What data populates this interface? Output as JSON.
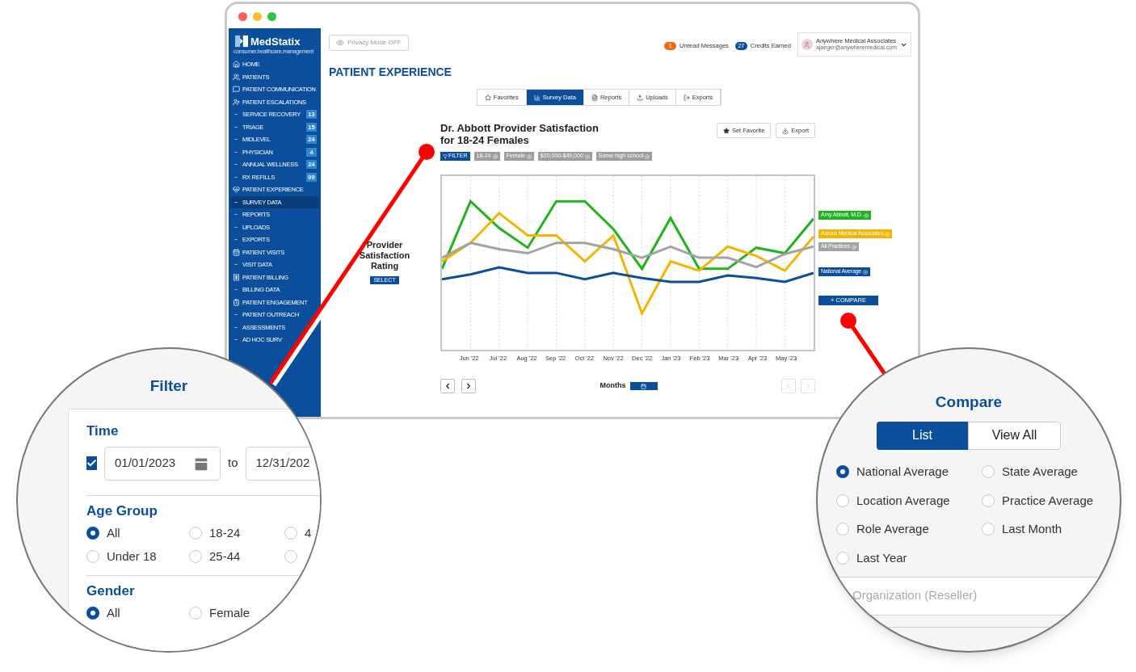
{
  "logo": {
    "name": "MedStatix",
    "tagline": "consumer.healthcare.management"
  },
  "sidebar": {
    "items": [
      {
        "kind": "section",
        "label": "HOME",
        "selected": false
      },
      {
        "kind": "section",
        "label": "PATIENTS",
        "selected": false
      },
      {
        "kind": "section",
        "label": "PATIENT COMMUNICATION",
        "selected": false
      },
      {
        "kind": "section",
        "label": "PATIENT ESCALATIONS",
        "selected": false
      },
      {
        "kind": "sub",
        "label": "SERVICE RECOVERY",
        "count": "13",
        "selected": false
      },
      {
        "kind": "sub",
        "label": "TRIAGE",
        "count": "15",
        "selected": false
      },
      {
        "kind": "sub",
        "label": "MIDLEVEL",
        "count": "24",
        "selected": false
      },
      {
        "kind": "sub",
        "label": "PHYSICIAN",
        "count": "4",
        "selected": false
      },
      {
        "kind": "sub",
        "label": "ANNUAL WELLNESS",
        "count": "24",
        "selected": false
      },
      {
        "kind": "sub",
        "label": "RX REFILLS",
        "count": "99",
        "selected": false
      },
      {
        "kind": "section",
        "label": "PATIENT EXPERIENCE",
        "selected": false
      },
      {
        "kind": "sub",
        "label": "SURVEY DATA",
        "selected": true
      },
      {
        "kind": "sub",
        "label": "REPORTS",
        "selected": false
      },
      {
        "kind": "sub",
        "label": "UPLOADS",
        "selected": false
      },
      {
        "kind": "sub",
        "label": "EXPORTS",
        "selected": false
      },
      {
        "kind": "section",
        "label": "PATIENT VISITS",
        "selected": false
      },
      {
        "kind": "sub",
        "label": "VISIT DATA",
        "selected": false
      },
      {
        "kind": "section",
        "label": "PATIENT BILLING",
        "selected": false
      },
      {
        "kind": "sub",
        "label": "BILLING DATA",
        "selected": false
      },
      {
        "kind": "section",
        "label": "PATIENT ENGAGEMENT",
        "selected": false
      },
      {
        "kind": "sub",
        "label": "PATIENT OUTREACH",
        "selected": false
      },
      {
        "kind": "sub",
        "label": "ASSESSMENTS",
        "selected": false
      },
      {
        "kind": "sub",
        "label": "AD HOC SURV",
        "selected": false
      }
    ]
  },
  "topbar": {
    "privacy_button": "Privacy Mode OFF",
    "unread": {
      "count": "1",
      "label": "Unread Messages"
    },
    "credits": {
      "count": "27",
      "label": "Credits Earned"
    },
    "account": {
      "name": "Anywhere Medical Associates",
      "email": "ajaeger@anywheremedical.com"
    }
  },
  "heading": "PATIENT EXPERIENCE",
  "tabs": [
    {
      "label": "Favorites",
      "selected": false
    },
    {
      "label": "Survey Data",
      "selected": true
    },
    {
      "label": "Reports",
      "selected": false
    },
    {
      "label": "Uploads",
      "selected": false
    },
    {
      "label": "Exports",
      "selected": false
    }
  ],
  "chart_panel": {
    "title": "Dr. Abbott Provider Satisfaction for 18-24 Females",
    "buttons": [
      "Set Favorite",
      "Export"
    ],
    "filter_button": "FILTER",
    "chips": [
      "18-24",
      "Female",
      "$20,000-$49,000",
      "Some high school"
    ],
    "metric": {
      "label": "Provider Satisfaction Rating",
      "button": "SELECT"
    },
    "x_labels": [
      "Jun '22",
      "Jul '22",
      "Aug '22",
      "Sep '22",
      "Oct '22",
      "Nov '22",
      "Dec '22",
      "Jan '23",
      "Feb '23",
      "Mar '23",
      "Apr '23",
      "May '23"
    ],
    "legend": [
      {
        "label": "Amy Abbott, M.D.",
        "color": "#22b21f"
      },
      {
        "label": "Aurora Medical Associates",
        "color": "#f5b400"
      },
      {
        "label": "All Practices",
        "color": "#a3a3a3"
      },
      {
        "label": "National Average",
        "color": "#0b4f9c"
      }
    ],
    "compare_button": "+ COMPARE",
    "period_label": "Months"
  },
  "filter_zoom": {
    "title": "Filter",
    "time": {
      "heading": "Time",
      "checked": true,
      "from": "01/01/2023",
      "to_label": "to",
      "to": "12/31/202"
    },
    "age_group": {
      "heading": "Age Group",
      "options": [
        {
          "label": "All",
          "selected": true
        },
        {
          "label": "18-24",
          "selected": false
        },
        {
          "label": "4",
          "selected": false
        },
        {
          "label": "Under 18",
          "selected": false
        },
        {
          "label": "25-44",
          "selected": false
        },
        {
          "selected": false
        }
      ]
    },
    "gender": {
      "heading": "Gender",
      "options": [
        {
          "label": "All",
          "selected": true
        },
        {
          "label": "Female",
          "selected": false
        }
      ]
    }
  },
  "compare_zoom": {
    "title": "Compare",
    "views": [
      {
        "label": "List",
        "selected": true
      },
      {
        "label": "View All",
        "selected": false
      }
    ],
    "options": [
      {
        "label": "National Average",
        "selected": true
      },
      {
        "label": "State Average",
        "selected": false
      },
      {
        "label": "Location Average",
        "selected": false
      },
      {
        "label": "Practice Average",
        "selected": false
      },
      {
        "label": "Role Average",
        "selected": false
      },
      {
        "label": "Last Month",
        "selected": false
      },
      {
        "label": "Last Year",
        "selected": false
      }
    ],
    "field_placeholder": "Organization (Reseller)"
  }
}
